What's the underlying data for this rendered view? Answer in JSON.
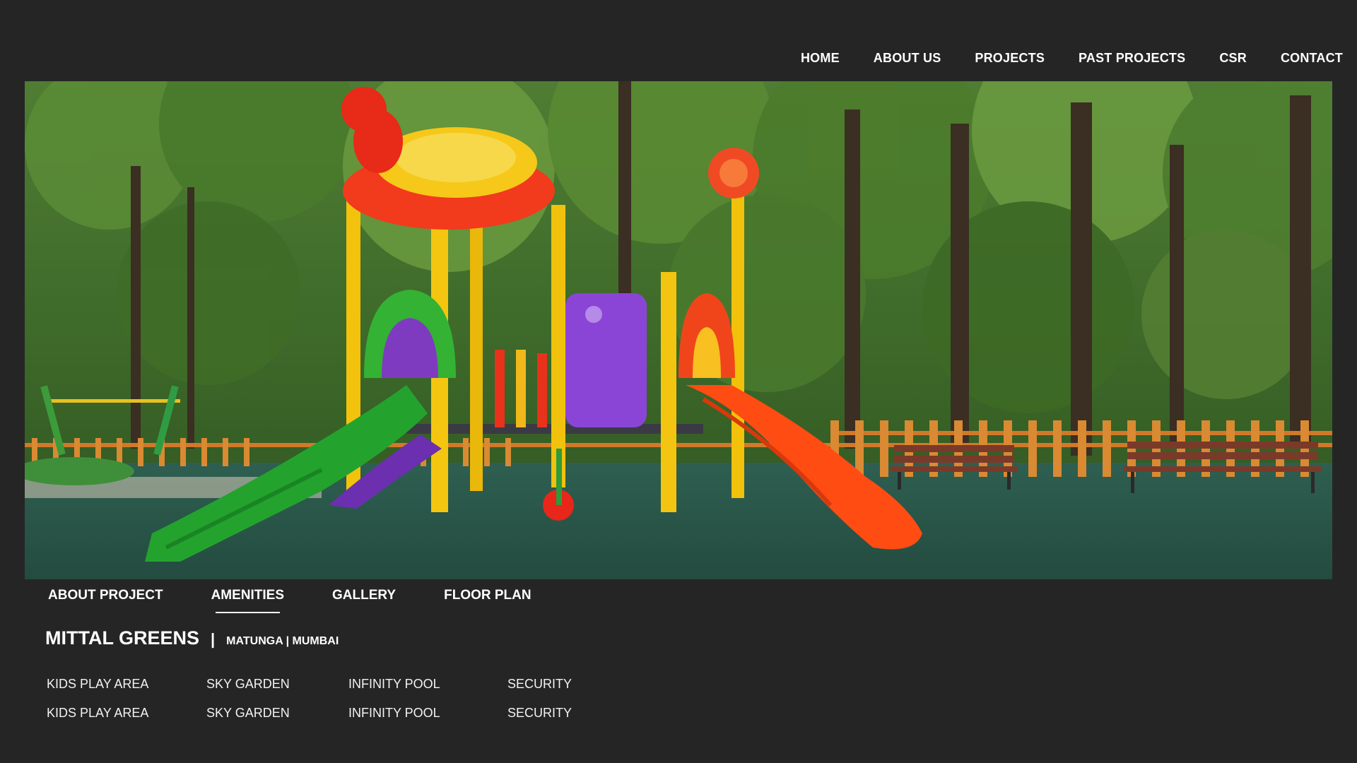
{
  "nav": {
    "items": [
      {
        "label": "HOME"
      },
      {
        "label": "ABOUT US"
      },
      {
        "label": "PROJECTS"
      },
      {
        "label": "PAST PROJECTS"
      },
      {
        "label": "CSR"
      },
      {
        "label": "CONTACT"
      }
    ]
  },
  "hero": {
    "image": "playground-in-park-photo"
  },
  "subnav": {
    "tabs": [
      {
        "label": "ABOUT PROJECT",
        "active": false
      },
      {
        "label": "AMENITIES",
        "active": true
      },
      {
        "label": "GALLERY",
        "active": false
      },
      {
        "label": "FLOOR PLAN",
        "active": false
      }
    ]
  },
  "project": {
    "name": "MITTAL GREENS",
    "separator": "|",
    "location": "MATUNGA | MUMBAI"
  },
  "amenities": {
    "rows": [
      [
        "KIDS PLAY AREA",
        "SKY GARDEN",
        "INFINITY POOL",
        "SECURITY"
      ],
      [
        "KIDS PLAY AREA",
        "SKY GARDEN",
        "INFINITY POOL",
        "SECURITY"
      ]
    ]
  },
  "colors": {
    "background": "#252525",
    "text": "#ffffff"
  }
}
